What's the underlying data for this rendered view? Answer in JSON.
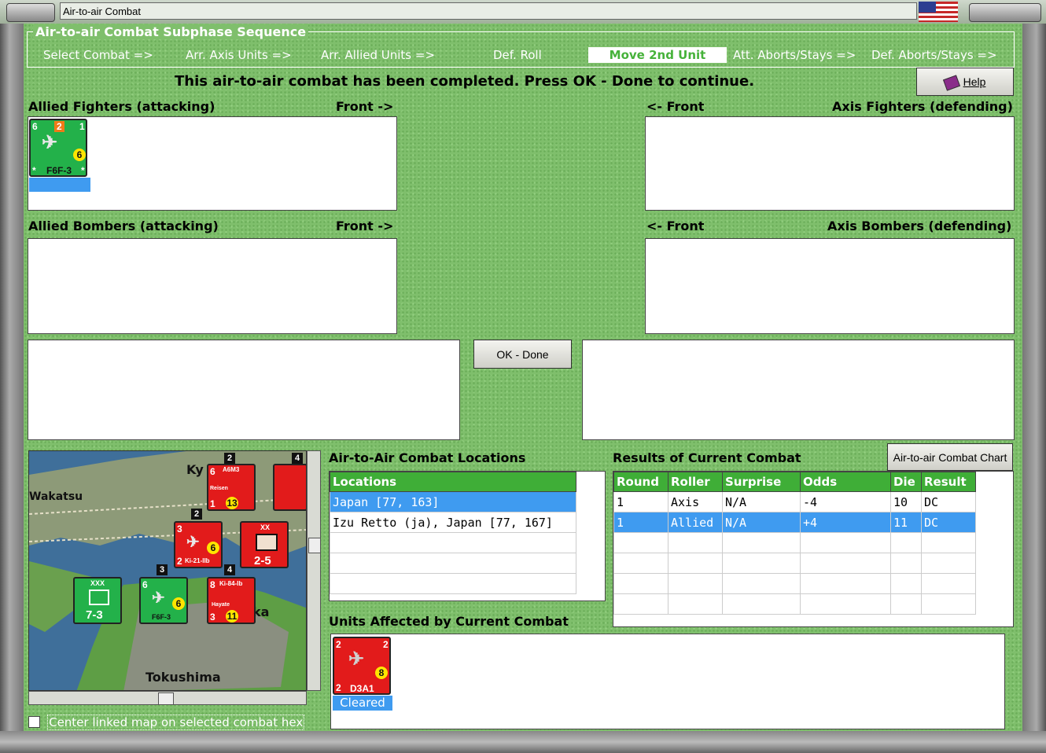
{
  "window": {
    "title": "Air-to-air Combat"
  },
  "sequence": {
    "title": "Air-to-air Combat Subphase Sequence",
    "steps": [
      "Select Combat =>",
      "Arr. Axis Units =>",
      "Arr. Allied Units =>",
      "Def. Roll",
      "Move 2nd Unit",
      "Att. Aborts/Stays =>",
      "Def. Aborts/Stays =>"
    ],
    "current": "Move 2nd Unit"
  },
  "status_message": "This air-to-air combat has been completed.  Press OK - Done to continue.",
  "help_button": "Help",
  "panels": {
    "allied_fighters": "Allied Fighters (attacking)",
    "allied_bombers": "Allied Bombers (attacking)",
    "axis_fighters": "Axis Fighters (defending)",
    "axis_bombers": "Axis Bombers (defending)",
    "front_right": "Front ->",
    "front_left": "<- Front"
  },
  "allied_fighter_unit": {
    "top_left": "6",
    "badge": "2",
    "top_right": "1",
    "strength": "6",
    "name": "F6F-3",
    "corner_left": "*",
    "corner_right": "*"
  },
  "ok_button": "OK - Done",
  "locations": {
    "title": "Air-to-Air Combat Locations",
    "header": "Locations",
    "rows": [
      "Japan [77, 163]",
      "Izu Retto (ja), Japan [77, 167]"
    ],
    "selected_index": 0
  },
  "results": {
    "title": "Results of Current Combat",
    "chart_button": "Air-to-air Combat Chart",
    "headers": [
      "Round",
      "Roller",
      "Surprise",
      "Odds",
      "Die",
      "Result"
    ],
    "rows": [
      [
        "1",
        "Axis",
        "N/A",
        "-4",
        "10",
        "DC"
      ],
      [
        "1",
        "Allied",
        "N/A",
        "+4",
        "11",
        "DC"
      ]
    ],
    "selected_index": 1
  },
  "affected": {
    "title": "Units Affected by Current Combat",
    "unit": {
      "top_left": "2",
      "top_right": "2",
      "strength": "8",
      "bottom_left": "2",
      "name": "D3A1",
      "status": "Cleared"
    }
  },
  "map": {
    "labels": [
      "Ky",
      "Wakatsu",
      "Tokushima",
      "ka"
    ],
    "hex_numbers": [
      "2",
      "4",
      "2",
      "3",
      "4"
    ],
    "counters": [
      {
        "name": "A6M3",
        "sub": "Reisen",
        "tl": "6",
        "strength": "13",
        "bl": "1"
      },
      {
        "name": "Ki-21-IIb",
        "tl": "3",
        "strength": "6",
        "bl": "2"
      },
      {
        "name": "2-5",
        "tl": "XX",
        "strength": "",
        "bl": ""
      },
      {
        "name": "Ki-84-Ib",
        "sub": "Hayate",
        "tl": "8",
        "strength": "11",
        "bl": "3"
      },
      {
        "name": "7-3",
        "tl": "XXX",
        "strength": "",
        "bl": ""
      },
      {
        "name": "F6F-3",
        "tl": "6",
        "strength": "6",
        "bl": "2"
      }
    ]
  },
  "center_checkbox": {
    "label": "Center linked map on selected combat hex",
    "checked": false
  },
  "colors": {
    "felt": "#7fbf6c",
    "header_green": "#3fae37",
    "selection_blue": "#3f9bf0",
    "axis_red": "#e21b1b",
    "allied_green": "#23b14a"
  }
}
